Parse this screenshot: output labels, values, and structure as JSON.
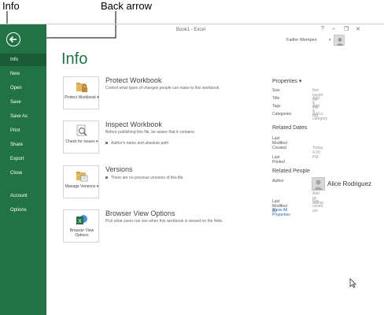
{
  "callouts": {
    "info": "Info",
    "back_arrow": "Back arrow"
  },
  "window": {
    "title": "Book1 - Excel",
    "help": "?",
    "minimize": "–",
    "restore": "❐",
    "close": "✕",
    "user_name": "Faithe Wempen"
  },
  "sidebar": {
    "items": [
      "Info",
      "New",
      "Open",
      "Save",
      "Save As",
      "Print",
      "Share",
      "Export",
      "Close",
      "Account",
      "Options"
    ]
  },
  "main": {
    "page_title": "Info",
    "sections": [
      {
        "button_label": "Protect Workbook ▾",
        "title": "Protect Workbook",
        "desc": "Control what types of changes people can make to this workbook.",
        "bullet": "",
        "icon": "lock-folder-icon"
      },
      {
        "button_label": "Check for Issues ▾",
        "title": "Inspect Workbook",
        "desc": "Before publishing this file, be aware that it contains:",
        "bullet": "Author's name and absolute path",
        "icon": "inspect-magnifier-icon"
      },
      {
        "button_label": "Manage Versions ▾",
        "title": "Versions",
        "desc": "There are no previous versions of this file.",
        "bullet": "",
        "icon": "versions-folder-icon"
      },
      {
        "button_label": "Browser View Options",
        "title": "Browser View Options",
        "desc": "Pick what users can see when this workbook is viewed on the Web.",
        "bullet": "",
        "icon": "excel-browser-icon"
      }
    ]
  },
  "properties": {
    "heading": "Properties ▾",
    "rows": [
      {
        "label": "Size",
        "value": "Not saved yet"
      },
      {
        "label": "Title",
        "value": "Add a title"
      },
      {
        "label": "Tags",
        "value": "Add a tag"
      },
      {
        "label": "Categories",
        "value": "Add a category"
      }
    ]
  },
  "related_dates": {
    "heading": "Related Dates",
    "rows": [
      {
        "label": "Last Modified",
        "value": ""
      },
      {
        "label": "Created",
        "value": "Today, 4:29 PM"
      },
      {
        "label": "Last Printed",
        "value": ""
      }
    ]
  },
  "related_people": {
    "heading": "Related People",
    "author_label": "Author",
    "author_name": "Alice Rodriguez",
    "add_author": "Add an author",
    "last_modified_by_label": "Last Modified By",
    "last_modified_by_value": "Not saved yet",
    "show_all": "Show All Properties"
  },
  "colors": {
    "sidebar": "#217346",
    "active_item": "#1a5c38",
    "title": "#217346",
    "link": "#2e6db4"
  }
}
